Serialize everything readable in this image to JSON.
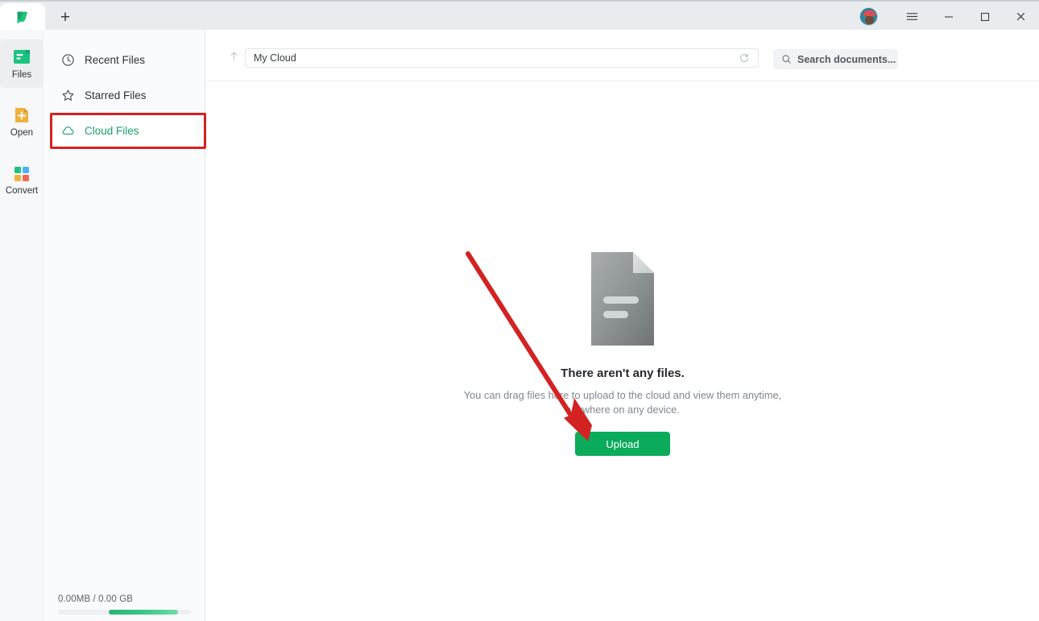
{
  "window": {
    "tab_logo_icon": "leaf-logo-icon",
    "new_tab_label": "+",
    "menu_icon": "hamburger-menu-icon",
    "minimize_icon": "minimize-icon",
    "maximize_icon": "maximize-icon",
    "close_icon": "close-icon",
    "avatar_name": "user-avatar"
  },
  "rail": {
    "items": [
      {
        "label": "Files",
        "icon": "files-icon",
        "active": true
      },
      {
        "label": "Open",
        "icon": "open-file-icon",
        "active": false
      },
      {
        "label": "Convert",
        "icon": "convert-grid-icon",
        "active": false
      }
    ]
  },
  "sidebar": {
    "items": [
      {
        "label": "Recent Files",
        "icon": "clock-icon"
      },
      {
        "label": "Starred Files",
        "icon": "star-icon"
      },
      {
        "label": "Cloud Files",
        "icon": "cloud-icon"
      }
    ],
    "storage": {
      "text": "0.00MB  / 0.00 GB",
      "used": "0.00MB",
      "total": "0.00 GB"
    }
  },
  "toolbar": {
    "up_icon": "arrow-up-icon",
    "path_value": "My Cloud",
    "refresh_icon": "refresh-icon",
    "search_icon": "search-icon",
    "search_placeholder": "Search documents...",
    "actions": [
      {
        "name": "list-view-icon",
        "disabled": false
      },
      {
        "name": "trash-icon",
        "disabled": true
      },
      {
        "name": "new-folder-icon",
        "disabled": false
      },
      {
        "name": "upload-share-icon",
        "disabled": false
      }
    ]
  },
  "empty_state": {
    "doc_icon": "document-icon",
    "title": "There aren't any files.",
    "subtitle": "You can drag files here to upload to the cloud and view them anytime, anywhere on any device.",
    "upload_label": "Upload"
  },
  "annotations": {
    "highlight_color": "#d32222",
    "arrow_color": "#d32222"
  },
  "colors": {
    "accent_green": "#0bab5c",
    "active_nav_green": "#18a06a",
    "titlebar": "#e9ecef",
    "sidebar": "#fafbfc"
  }
}
